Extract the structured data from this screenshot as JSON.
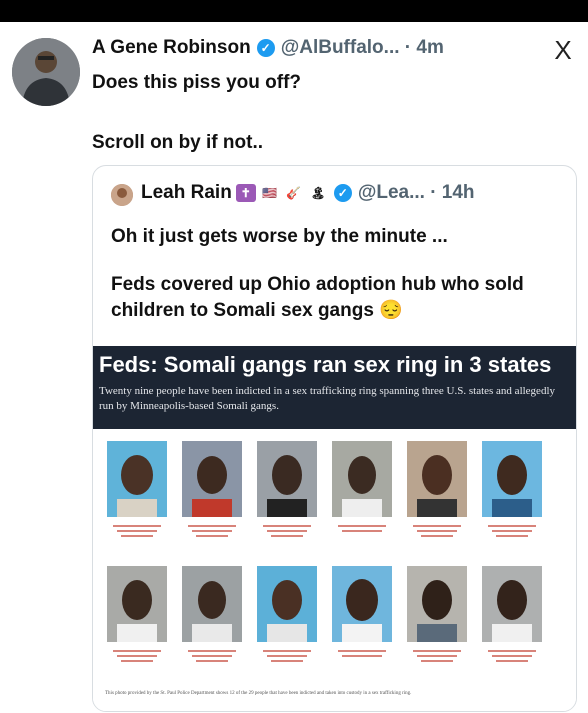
{
  "post": {
    "author_name": "A Gene Robinson",
    "handle_time": "@AlBuffalo... · 4m",
    "line1": "Does this piss you off?",
    "line2": "Scroll on by if not.."
  },
  "close_glyph": "X",
  "quote": {
    "author_name": "Leah Rain",
    "emojis": [
      "✝",
      "🇺🇸",
      "🎸",
      "🏝"
    ],
    "handle_time": "@Lea... · 14h",
    "para1": "Oh it just gets worse by the minute ...",
    "para2": "Feds covered up Ohio adoption hub who sold children to Somali sex gangs 😔"
  },
  "article": {
    "title": "Feds: Somali gangs ran sex ring in 3 states",
    "subtitle": "Twenty nine people have been indicted in a sex trafficking ring spanning three U.S. states and allegedly run by Minneapolis-based Somali gangs.",
    "footer": "This photo provided by the St. Paul Police Department shows 12 of the 29 people that have been indicted and taken into custody in a sex trafficking ring."
  },
  "colors": {
    "verified": "#1d9bf0",
    "article_header": "#1c2533",
    "caption_red": "#c0392b"
  }
}
